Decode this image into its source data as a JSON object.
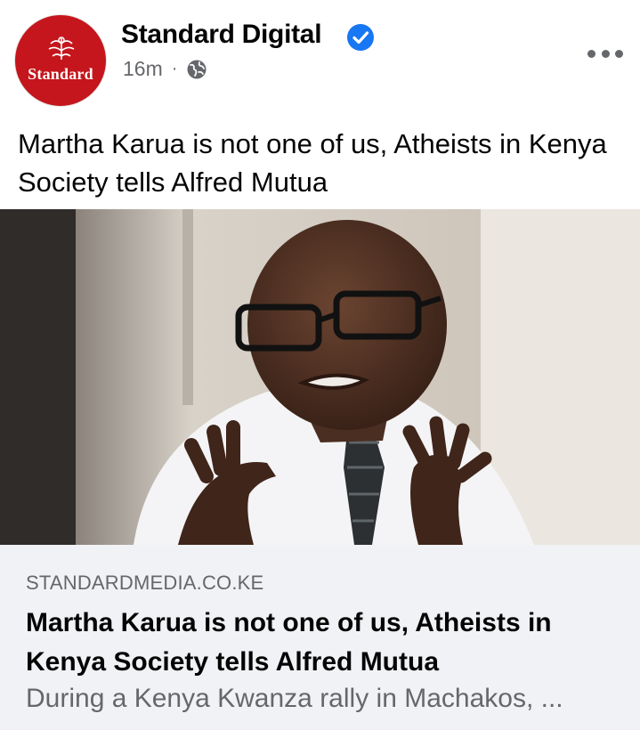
{
  "post": {
    "page_name": "Standard Digital",
    "avatar_wordmark": "Standard",
    "timestamp": "16m",
    "separator": "·",
    "audience_icon": "globe-icon",
    "text": "Martha Karua is not one of us, Atheists in Kenya Society tells Alfred Mutua"
  },
  "link_preview": {
    "domain": "STANDARDMEDIA.CO.KE",
    "title": "Martha Karua is not one of us, Atheists in Kenya Society tells Alfred Mutua",
    "description": "During a Kenya Kwanza rally in Machakos, ..."
  },
  "colors": {
    "brand_red": "#c4161c",
    "verified_blue": "#1877f2",
    "secondary_text": "#65676b",
    "link_card_bg": "#f0f2f5"
  }
}
